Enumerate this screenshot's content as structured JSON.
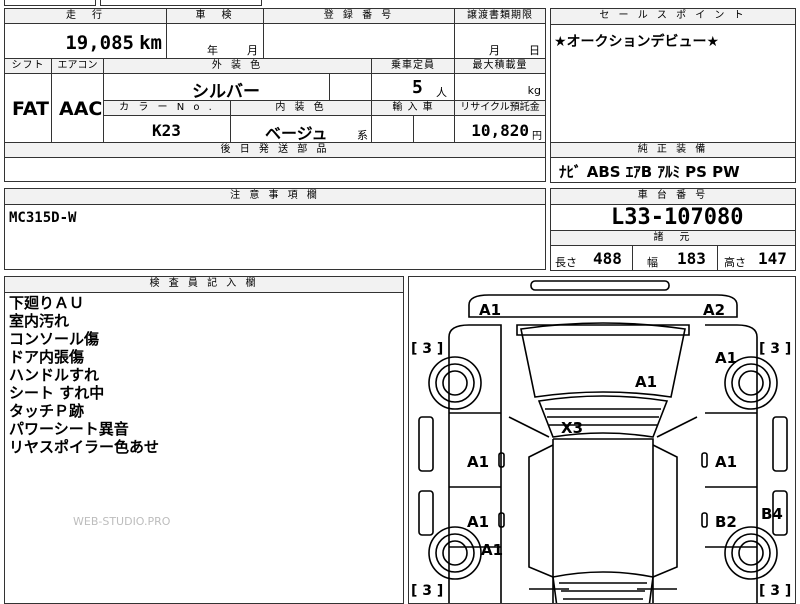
{
  "labels": {
    "mileage": "走　行",
    "inspection": "車　検",
    "reg_number": "登 録 番 号",
    "transfer_deadline": "譲渡書類期限",
    "sales_point": "セ ー ル ス ポ イ ン ト",
    "shift": "シフト",
    "aircon": "エアコン",
    "exterior_color": "外 装 色",
    "capacity": "乗車定員",
    "max_load": "最大積載量",
    "color_no": "カ ラ ー N o .",
    "interior_color": "内 装 色",
    "import": "輸 入 車",
    "recycle": "リサイクル預託金",
    "later_parts": "後 日 発 送 部 品",
    "equipment": "純 正 装 備",
    "caution": "注 意 事 項 欄",
    "chassis_no": "車 台 番 号",
    "specs": "諸　元",
    "inspector": "検 査 員 記 入 欄",
    "length": "長さ",
    "width": "幅",
    "height": "高さ"
  },
  "vehicle": {
    "mileage": "19,085",
    "mileage_unit": "km",
    "year_label": "年",
    "month_label": "月",
    "deadline_month": "月",
    "deadline_day": "日",
    "shift": "FAT",
    "aircon": "AAC",
    "exterior_color": "シルバー",
    "capacity": "5",
    "capacity_unit": "人",
    "load_unit": "kg",
    "color_no": "K23",
    "interior_color": "ベージュ",
    "interior_suffix": "系",
    "recycle": "10,820",
    "recycle_unit": "円",
    "sales_point": "★オークションデビュー★",
    "equipment": "ﾅﾋﾞ ABS ｴｱB ｱﾙﾐ PS PW",
    "caution": "MC315D-W",
    "chassis_no": "L33-107080",
    "length": "488",
    "width": "183",
    "height": "147"
  },
  "inspector_notes": [
    "下廻りＡＵ",
    "室内汚れ",
    "コンソール傷",
    "ドア内張傷",
    "ハンドルすれ",
    "シート すれ中",
    "タッチＰ跡",
    "パワーシート異音",
    "リヤスポイラー色あせ"
  ],
  "watermark": "WEB-STUDIO.PRO",
  "damage_marks": {
    "front_left": "A1",
    "front_right": "A2",
    "right_fender": "A1",
    "bonnet": "A1",
    "roof": "X3",
    "left_front_door": "A1",
    "right_front_door": "A1",
    "left_rear_door": "A1",
    "right_rear_door": "B2",
    "left_rear_fender": "A1",
    "right_rear_fender": "B4",
    "tire_fl": "[ 3 ]",
    "tire_fr": "[ 3 ]",
    "tire_rl": "[ 3 ]",
    "tire_rr": "[ 3 ]"
  }
}
